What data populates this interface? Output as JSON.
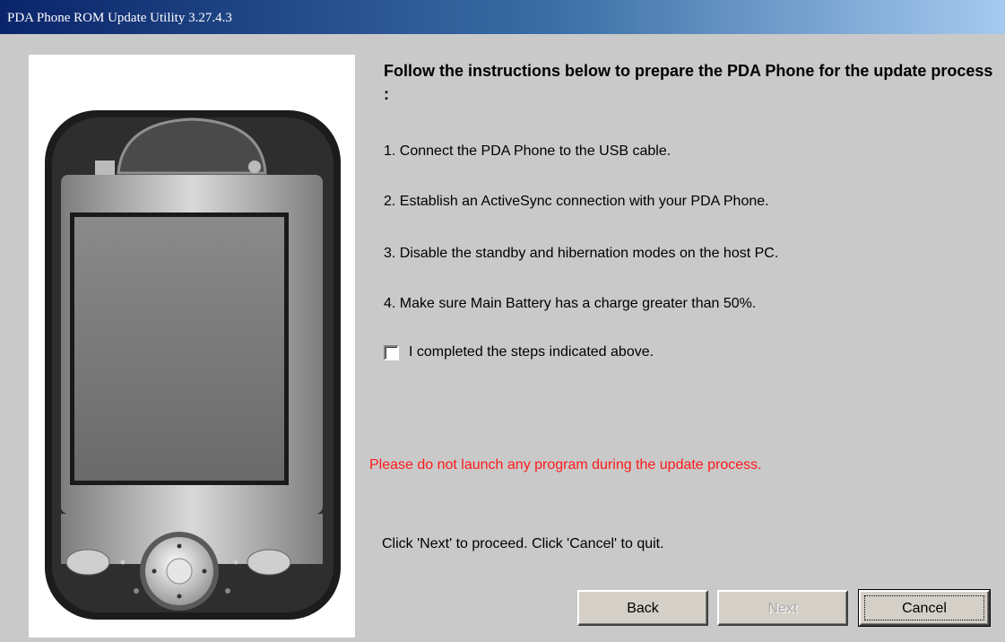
{
  "window": {
    "title": "PDA Phone ROM Update Utility 3.27.4.3"
  },
  "instructions": {
    "heading": "Follow the instructions below to prepare the PDA Phone for the update process :",
    "steps": [
      "1. Connect the PDA Phone to the USB cable.",
      "2. Establish an ActiveSync connection with your PDA Phone.",
      "3. Disable the standby and hibernation modes on the host PC.",
      "4. Make sure Main Battery has a charge greater than 50%."
    ],
    "checkbox_label": "I completed the steps indicated above.",
    "checkbox_checked": false
  },
  "warning": "Please do not launch any program during the update process.",
  "proceed_text": "Click 'Next' to proceed. Click 'Cancel' to quit.",
  "buttons": {
    "back": "Back",
    "next": "Next",
    "cancel": "Cancel"
  },
  "colors": {
    "warning": "#ff1a1a",
    "titlebar_start": "#0a246a",
    "titlebar_end": "#a6caf0",
    "background": "#c9c9c9"
  }
}
